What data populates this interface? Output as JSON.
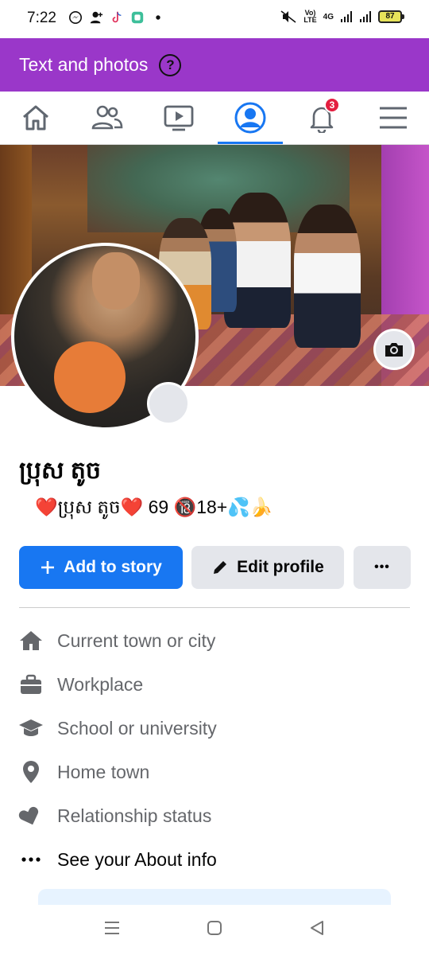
{
  "status_bar": {
    "time": "7:22",
    "network": "4G",
    "battery": "87",
    "volte_top": "Vo)",
    "volte_bottom": "LTE"
  },
  "banner": {
    "title": "Text and photos",
    "help_icon": "question-circle-icon"
  },
  "nav": {
    "items": [
      {
        "name": "home",
        "icon": "home-icon"
      },
      {
        "name": "friends",
        "icon": "friends-icon"
      },
      {
        "name": "watch",
        "icon": "video-icon"
      },
      {
        "name": "profile",
        "icon": "profile-icon",
        "active": true
      },
      {
        "name": "notifications",
        "icon": "bell-icon",
        "badge": "3"
      },
      {
        "name": "menu",
        "icon": "hamburger-icon"
      }
    ]
  },
  "profile": {
    "name": "ប្រុស តូច",
    "bio": "❤️ប្រុស តូច❤️ 69  🔞18+💦🍌"
  },
  "actions": {
    "add_to_story": "Add to story",
    "edit_profile": "Edit profile",
    "more": "•••"
  },
  "details": [
    {
      "icon": "house-icon",
      "label": "Current town or city"
    },
    {
      "icon": "briefcase-icon",
      "label": "Workplace"
    },
    {
      "icon": "graduation-cap-icon",
      "label": "School or university"
    },
    {
      "icon": "location-pin-icon",
      "label": "Home town"
    },
    {
      "icon": "heart-icon",
      "label": "Relationship status"
    },
    {
      "icon": "ellipsis-icon",
      "label": "See your About info"
    }
  ],
  "accent_colors": {
    "banner": "#9a37c9",
    "primary": "#1877f2",
    "badge": "#e41e3f"
  }
}
